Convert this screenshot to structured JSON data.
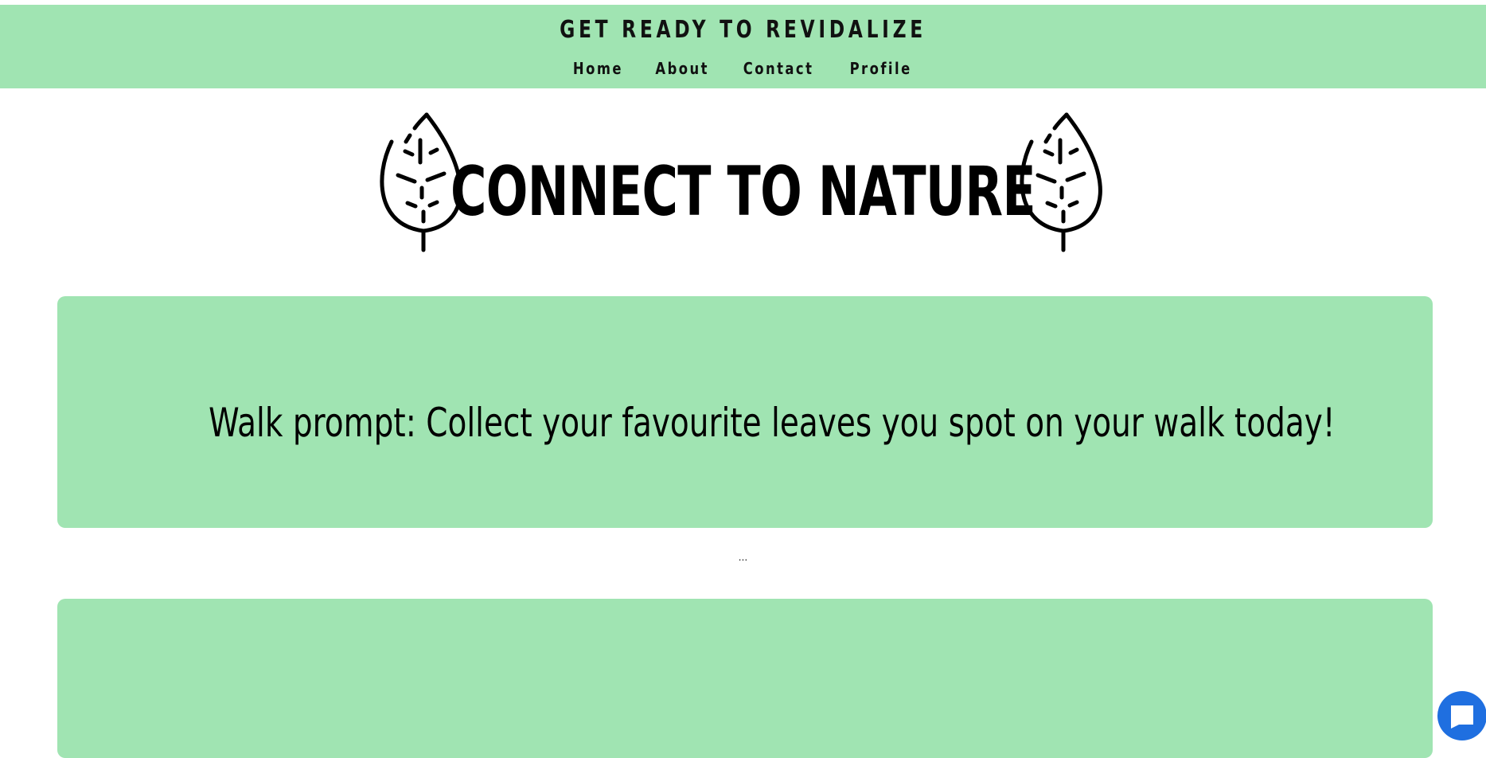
{
  "header": {
    "site_title": "GET READY TO REVIDALIZE",
    "nav": [
      {
        "label": "Home"
      },
      {
        "label": "About"
      },
      {
        "label": "Contact"
      },
      {
        "label": "Profile"
      }
    ],
    "background_color": "#a0e4b2"
  },
  "hero": {
    "title": "CONNECT TO NATURE",
    "left_icon": "leaf-icon",
    "right_icon": "leaf-icon"
  },
  "main": {
    "prompt_card": {
      "text": "Walk prompt: Collect your favourite leaves you spot on your walk today!"
    },
    "separator": "..."
  },
  "chat_widget": {
    "icon": "chat-bubble-icon",
    "color": "#1f6fe0"
  }
}
